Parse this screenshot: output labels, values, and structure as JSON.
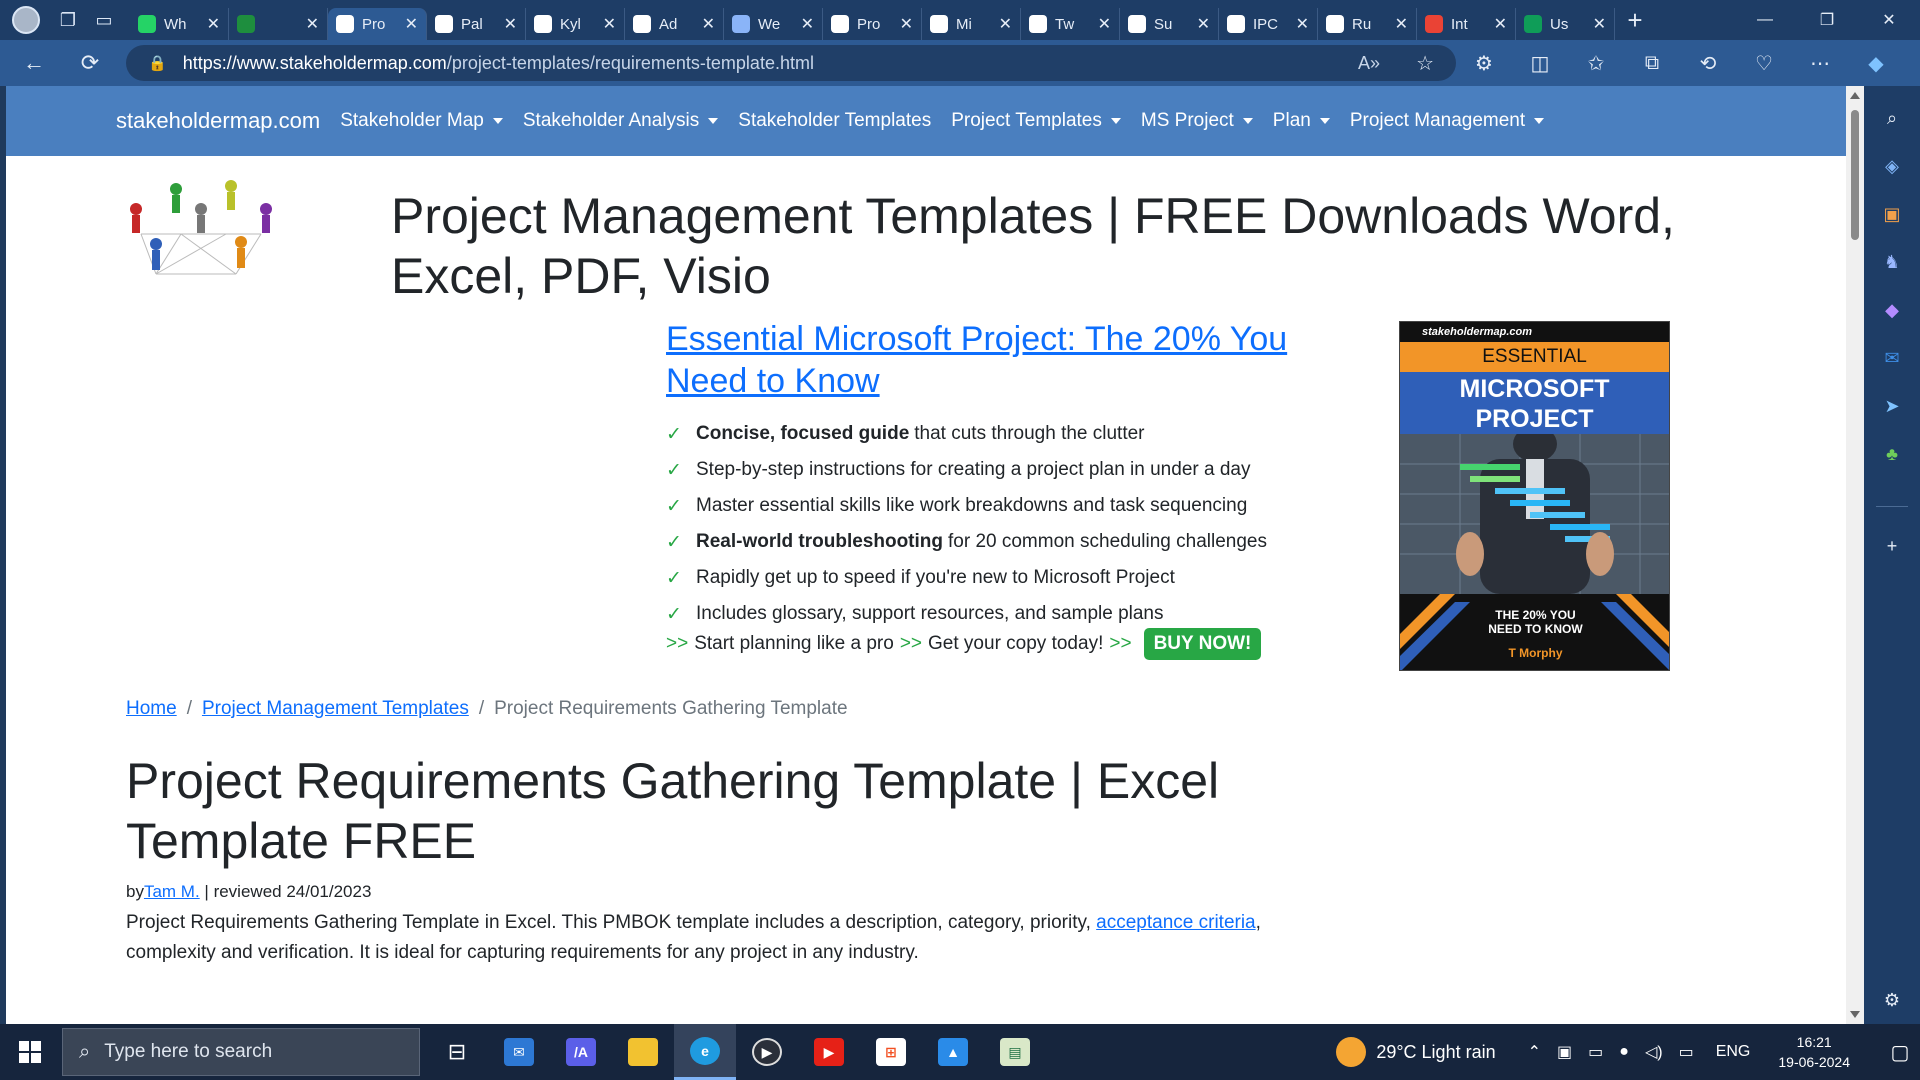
{
  "browser": {
    "tabs": [
      {
        "title": "Wh",
        "favicon": "whatsapp-icon",
        "color": "#25d366"
      },
      {
        "title": "",
        "favicon": "meet-icon",
        "color": "#1e8e3e"
      },
      {
        "title": "Pro",
        "favicon": "chart-favicon-icon",
        "color": "#ffffff",
        "active": true
      },
      {
        "title": "Pal",
        "favicon": "github-icon",
        "color": "#ffffff"
      },
      {
        "title": "Kyl",
        "favicon": "github-icon",
        "color": "#ffffff"
      },
      {
        "title": "Ad",
        "favicon": "openai-icon",
        "color": "#ffffff"
      },
      {
        "title": "We",
        "favicon": "link-icon",
        "color": "#8ab4f8"
      },
      {
        "title": "Pro",
        "favicon": "slash-icon",
        "color": "#ffffff"
      },
      {
        "title": "Mi",
        "favicon": "slash-icon",
        "color": "#ffffff"
      },
      {
        "title": "Tw",
        "favicon": "slash-icon",
        "color": "#ffffff"
      },
      {
        "title": "Su",
        "favicon": "slash-icon",
        "color": "#ffffff"
      },
      {
        "title": "IPC",
        "favicon": "slash-icon",
        "color": "#ffffff"
      },
      {
        "title": "Ru",
        "favicon": "slash-icon",
        "color": "#ffffff"
      },
      {
        "title": "Int",
        "favicon": "gmail-icon",
        "color": "#ea4335"
      },
      {
        "title": "Us",
        "favicon": "sheets-icon",
        "color": "#0f9d58"
      }
    ],
    "url_host": "https://www.stakeholdermap.com",
    "url_path": "/project-templates/requirements-template.html"
  },
  "site_nav": {
    "brand": "stakeholdermap.com",
    "items": [
      {
        "label": "Stakeholder Map",
        "dropdown": true
      },
      {
        "label": "Stakeholder Analysis",
        "dropdown": true
      },
      {
        "label": "Stakeholder Templates",
        "dropdown": false
      },
      {
        "label": "Project Templates",
        "dropdown": true
      },
      {
        "label": "MS Project",
        "dropdown": true
      },
      {
        "label": "Plan",
        "dropdown": true
      },
      {
        "label": "Project Management",
        "dropdown": true
      }
    ]
  },
  "header": {
    "title": "Project Management Templates | FREE Downloads Word, Excel, PDF, Visio"
  },
  "promo": {
    "link": "Essential Microsoft Project: The 20% You Need to Know",
    "features": [
      {
        "bold": "Concise, focused guide",
        "text": "that cuts through the clutter"
      },
      {
        "bold": "",
        "text": "Step-by-step instructions for creating a project plan in under a day"
      },
      {
        "bold": "",
        "text": "Master essential skills like work breakdowns and task sequencing"
      },
      {
        "bold": "Real-world troubleshooting",
        "text": "for 20 common scheduling challenges"
      },
      {
        "bold": "",
        "text": "Rapidly get up to speed if you're new to Microsoft Project"
      },
      {
        "bold": "",
        "text": "Includes glossary, support resources, and sample plans"
      }
    ],
    "check": "✓",
    "arrows": ">>",
    "cta_1": "Start planning like a pro",
    "cta_2": "Get your copy today!",
    "buy_label": "BUY NOW!"
  },
  "book": {
    "site": "stakeholdermap.com",
    "line1": "ESSENTIAL",
    "line2": "MICROSOFT",
    "line3": "PROJECT",
    "tagline1": "THE 20% YOU",
    "tagline2": "NEED TO KNOW",
    "author": "T Morphy"
  },
  "breadcrumb": {
    "home": "Home",
    "section": "Project Management Templates",
    "current": "Project Requirements Gathering Template",
    "sep": "/"
  },
  "article": {
    "title": "Project Requirements Gathering Template | Excel Template FREE",
    "by_prefix": "by",
    "author": "Tam M.",
    "reviewed": " | reviewed 24/01/2023",
    "intro_1": "Project Requirements Gathering Template in Excel. This PMBOK template includes a description, category, priority, ",
    "intro_link": "acceptance criteria",
    "intro_2": ", complexity and verification. It is ideal for capturing requirements for any project in any industry."
  },
  "taskbar": {
    "search_placeholder": "Type here to search",
    "weather": "29°C  Light rain",
    "lang": "ENG",
    "time": "16:21",
    "date": "19-06-2024"
  },
  "colors": {
    "nav_bg": "#4a7fbf",
    "link": "#0d6efd",
    "accent_green": "#28a745"
  }
}
